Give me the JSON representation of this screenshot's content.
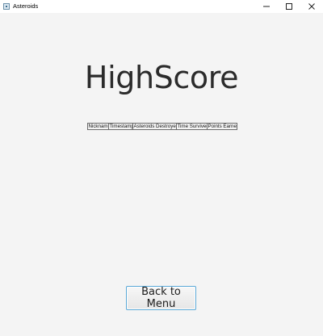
{
  "window": {
    "title": "Asteroids",
    "controls": {
      "minimize_icon": "minimize-icon",
      "maximize_icon": "maximize-icon",
      "close_icon": "close-icon"
    }
  },
  "page": {
    "heading": "HighScore"
  },
  "table": {
    "columns": [
      "Nickname",
      "Timestamp",
      "Asteroids Destroyed",
      "Time Survived",
      "Points Earned"
    ],
    "rows": []
  },
  "actions": {
    "back_label": "Back to Menu"
  },
  "colors": {
    "background": "#f4f4f4",
    "button_border": "#5aa8d6",
    "text": "#2b2b2b"
  }
}
